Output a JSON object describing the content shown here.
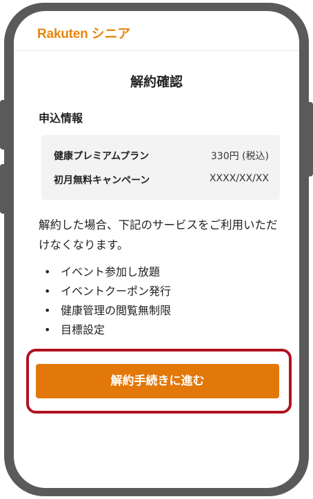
{
  "header": {
    "logo_text": "Rakuten シニア"
  },
  "page": {
    "title": "解約確認"
  },
  "application_info": {
    "heading": "申込情報",
    "rows": [
      {
        "label": "健康プレミアムプラン",
        "value": "330円 (税込)"
      },
      {
        "label": "初月無料キャンペーン",
        "value": "XXXX/XX/XX"
      }
    ]
  },
  "notice": {
    "text": "解約した場合、下記のサービスをご利用いただけなくなります。"
  },
  "services": {
    "bullet": "•",
    "items": [
      "イベント参加し放題",
      "イベントクーポン発行",
      "健康管理の閲覧無制限",
      "目標設定"
    ]
  },
  "actions": {
    "proceed_label": "解約手続きに進む"
  },
  "colors": {
    "brand": "#e8850b",
    "button": "#e2780a",
    "highlight_frame": "#b0121e",
    "device_frame": "#5a5a5a"
  }
}
